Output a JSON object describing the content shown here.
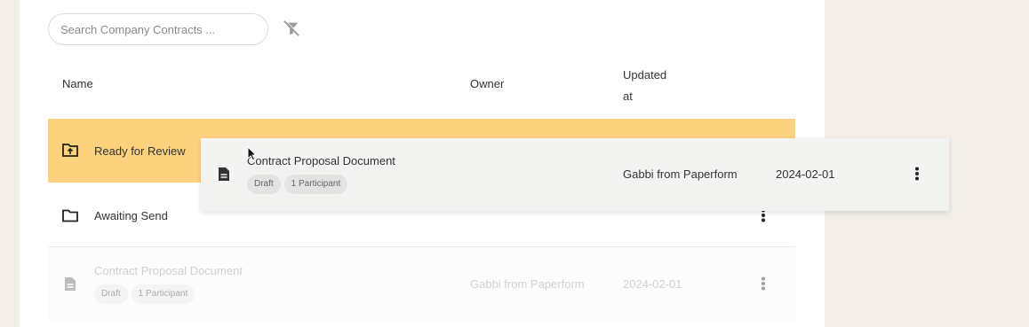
{
  "search": {
    "placeholder": "Search Company Contracts ...",
    "value": ""
  },
  "filter": {
    "icon": "filter-off-icon"
  },
  "table": {
    "headers": {
      "name": "Name",
      "owner": "Owner",
      "updated": "Updated at"
    }
  },
  "rows": {
    "ready": {
      "label": "Ready for Review",
      "icon": "folder-upload-icon"
    },
    "await": {
      "label": "Awaiting Send",
      "icon": "folder-icon"
    },
    "doc": {
      "name": "Contract Proposal Document",
      "tags": [
        "Draft",
        "1 Participant"
      ],
      "owner": "Gabbi from Paperform",
      "updated": "2024-02-01",
      "icon": "document-icon"
    }
  },
  "drag_preview": {
    "name": "Contract Proposal Document",
    "tags": [
      "Draft",
      "1 Participant"
    ],
    "owner": "Gabbi from Paperform",
    "updated": "2024-02-01",
    "icon": "document-icon"
  },
  "colors": {
    "highlight": "#fdd27e",
    "background": "#f3efe8"
  }
}
